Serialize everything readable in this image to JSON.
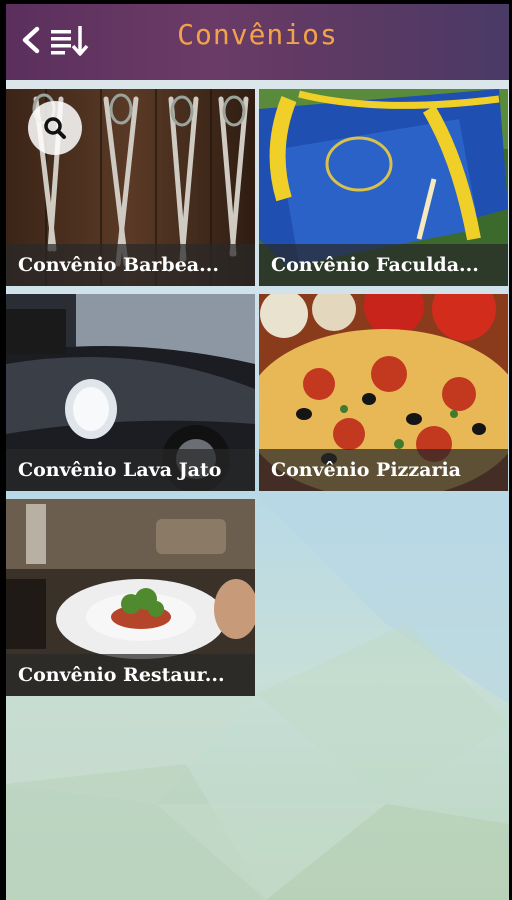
{
  "header": {
    "title": "Convênios",
    "back_icon": "chevron-left-icon",
    "sort_icon": "sort-list-icon"
  },
  "search": {
    "icon": "search-icon"
  },
  "colors": {
    "header_start": "#5b2f5d",
    "header_end": "#4a3a66",
    "title": "#f2a24a",
    "caption_bg": "#282828"
  },
  "tiles": [
    {
      "label": "Convênio Barbea...",
      "image": "scissors-photo"
    },
    {
      "label": "Convênio Faculda...",
      "image": "graduation-cap-photo"
    },
    {
      "label": "Convênio Lava Jato",
      "image": "car-photo"
    },
    {
      "label": "Convênio Pizzaria",
      "image": "pizza-photo"
    },
    {
      "label": "Convênio Restaur...",
      "image": "restaurant-plate-photo"
    }
  ]
}
